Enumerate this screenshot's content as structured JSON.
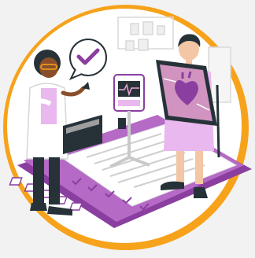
{
  "illustration": {
    "subject": "doctor-and-patient-heart-scan",
    "colors": {
      "background": "#f2f2f2",
      "ring": "#f6a21a",
      "disc": "#ffffff",
      "purple": "#8a3fa0",
      "purple_light": "#e9b8ee",
      "pink": "#f0a6d8",
      "dark": "#263238",
      "skin_dark": "#8a4f2a",
      "skin_light": "#f3c6a5",
      "line_gray": "#c9c9c9"
    }
  }
}
